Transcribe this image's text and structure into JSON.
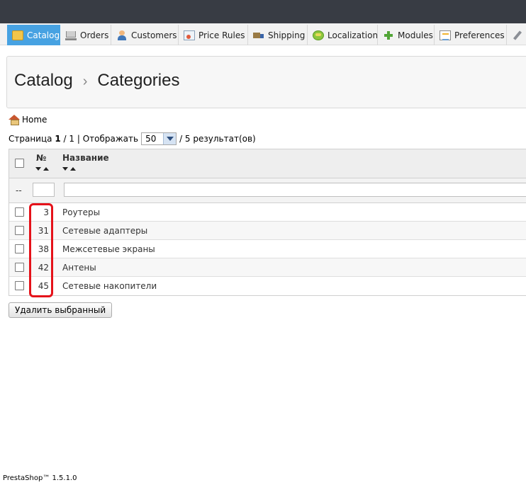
{
  "tabs": [
    {
      "label": "Catalog",
      "icon": "folder-icon",
      "active": true
    },
    {
      "label": "Orders",
      "icon": "cart-icon"
    },
    {
      "label": "Customers",
      "icon": "user-icon"
    },
    {
      "label": "Price Rules",
      "icon": "price-rules-icon"
    },
    {
      "label": "Shipping",
      "icon": "truck-icon"
    },
    {
      "label": "Localization",
      "icon": "globe-icon"
    },
    {
      "label": "Modules",
      "icon": "puzzle-icon"
    },
    {
      "label": "Preferences",
      "icon": "preferences-icon"
    },
    {
      "label": "",
      "icon": "wrench-icon"
    }
  ],
  "breadcrumb": {
    "section": "Catalog",
    "separator": "›",
    "page": "Categories"
  },
  "home_link": "Home",
  "pagination": {
    "page_prefix": "Страница",
    "current_page": "1",
    "page_suffix": "/ 1 | Отображать",
    "per_page": "50",
    "results": "/ 5 результат(ов)"
  },
  "table": {
    "columns": {
      "id": "№",
      "name": "Название"
    },
    "filter_placeholder": "--",
    "rows": [
      {
        "id": "3",
        "name": "Роутеры"
      },
      {
        "id": "31",
        "name": "Сетевые адаптеры"
      },
      {
        "id": "38",
        "name": "Межсетевые экраны"
      },
      {
        "id": "42",
        "name": "Антены"
      },
      {
        "id": "45",
        "name": "Сетевые накопители"
      }
    ]
  },
  "delete_button": "Удалить выбранный",
  "footer": "PrestaShop™ 1.5.1.0",
  "colors": {
    "active_tab": "#47a2e2",
    "topbar": "#383c44",
    "highlight": "#e5121a"
  }
}
